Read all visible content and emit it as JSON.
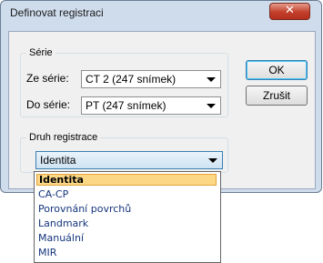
{
  "window": {
    "title": "Definovat registraci",
    "close_label": "✕"
  },
  "series_group": {
    "legend": "Série",
    "from_label": "Ze série:",
    "from_value": "CT 2 (247 snímek)",
    "to_label": "Do série:",
    "to_value": "PT  (247 snímek)"
  },
  "registration_group": {
    "legend": "Druh registrace",
    "selected_value": "Identita"
  },
  "buttons": {
    "ok_label": "OK",
    "cancel_label": "Zrušit"
  },
  "dropdown": {
    "items": [
      "Identita",
      "CA-CP",
      "Porovnání povrchů",
      "Landmark",
      "Manuální",
      "MIR"
    ],
    "selected_index": 0
  }
}
